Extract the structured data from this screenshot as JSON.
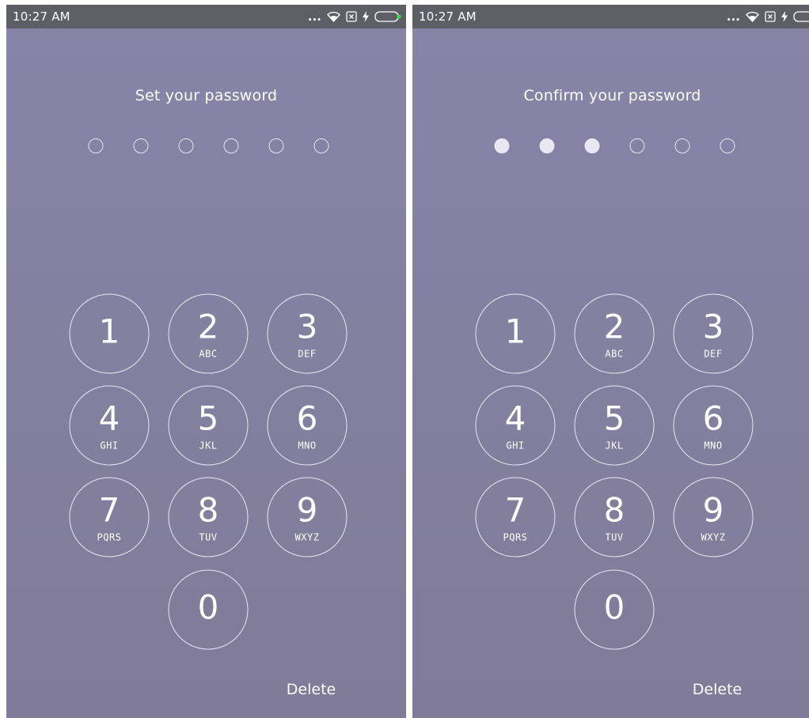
{
  "status_bar": {
    "time": "10:27 AM",
    "more_glyph": "...",
    "icons": [
      "wifi-icon",
      "sim-icon",
      "charging-icon",
      "battery-icon"
    ],
    "battery_accent": "#3fd24a"
  },
  "screens": [
    {
      "title": "Set your password",
      "filled_count": 0,
      "total_digits": 6,
      "delete_label": "Delete"
    },
    {
      "title": "Confirm your password",
      "filled_count": 3,
      "total_digits": 6,
      "delete_label": "Delete"
    }
  ],
  "keypad": {
    "keys": [
      {
        "digit": "1",
        "letters": ""
      },
      {
        "digit": "2",
        "letters": "ABC"
      },
      {
        "digit": "3",
        "letters": "DEF"
      },
      {
        "digit": "4",
        "letters": "GHI"
      },
      {
        "digit": "5",
        "letters": "JKL"
      },
      {
        "digit": "6",
        "letters": "MNO"
      },
      {
        "digit": "7",
        "letters": "PQRS"
      },
      {
        "digit": "8",
        "letters": "TUV"
      },
      {
        "digit": "9",
        "letters": "WXYZ"
      },
      {
        "digit": "0",
        "letters": ""
      }
    ]
  },
  "colors": {
    "background_top": "#8884a9",
    "background_bottom": "#7f7b98",
    "status_bar": "#5e5e66",
    "foreground": "#ffffff"
  }
}
